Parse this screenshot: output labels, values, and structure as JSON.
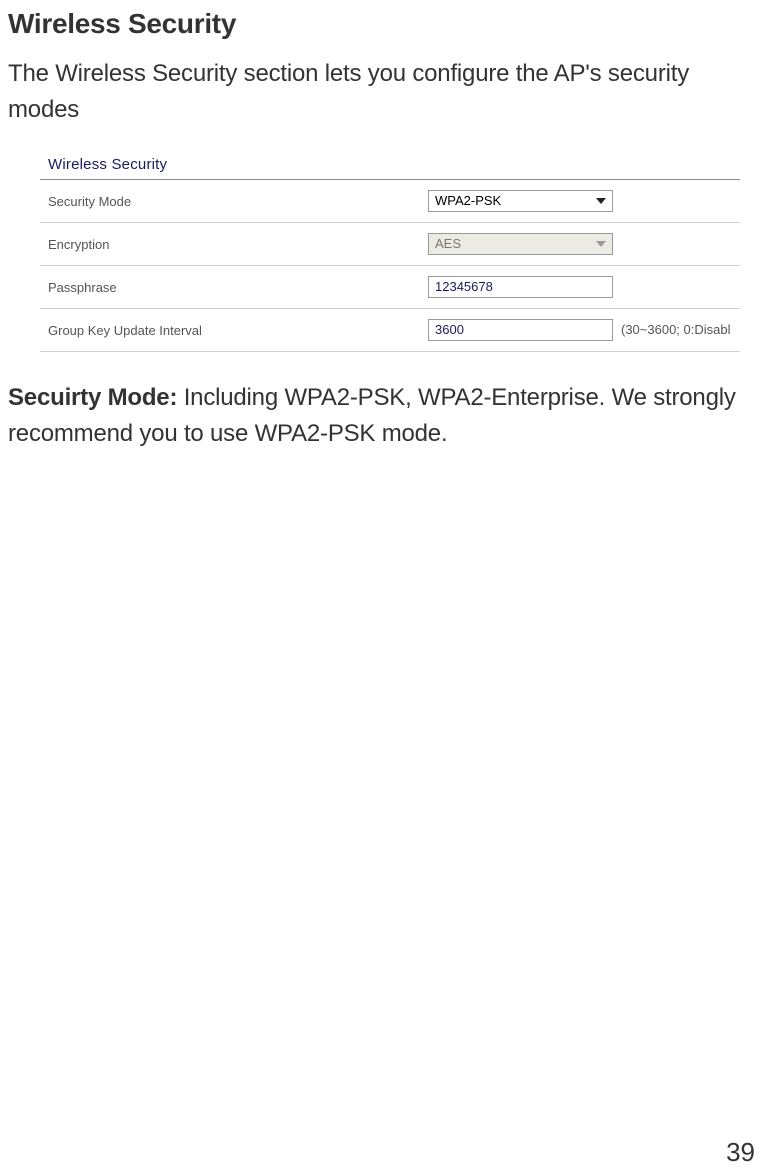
{
  "title": "Wireless Security",
  "intro": "The Wireless Security section lets you configure the AP's security modes",
  "settings": {
    "header": "Wireless Security",
    "rows": {
      "security_mode": {
        "label": "Security Mode",
        "value": "WPA2-PSK"
      },
      "encryption": {
        "label": "Encryption",
        "value": "AES"
      },
      "passphrase": {
        "label": "Passphrase",
        "value": "12345678"
      },
      "group_key": {
        "label": "Group Key Update Interval",
        "value": "3600",
        "hint": "(30~3600; 0:Disabl"
      }
    }
  },
  "paragraph": {
    "bold": "Secuirty Mode: ",
    "rest": "Including WPA2-PSK, WPA2-Enterprise. We strongly recommend you to use WPA2-PSK mode."
  },
  "page_number": "39"
}
